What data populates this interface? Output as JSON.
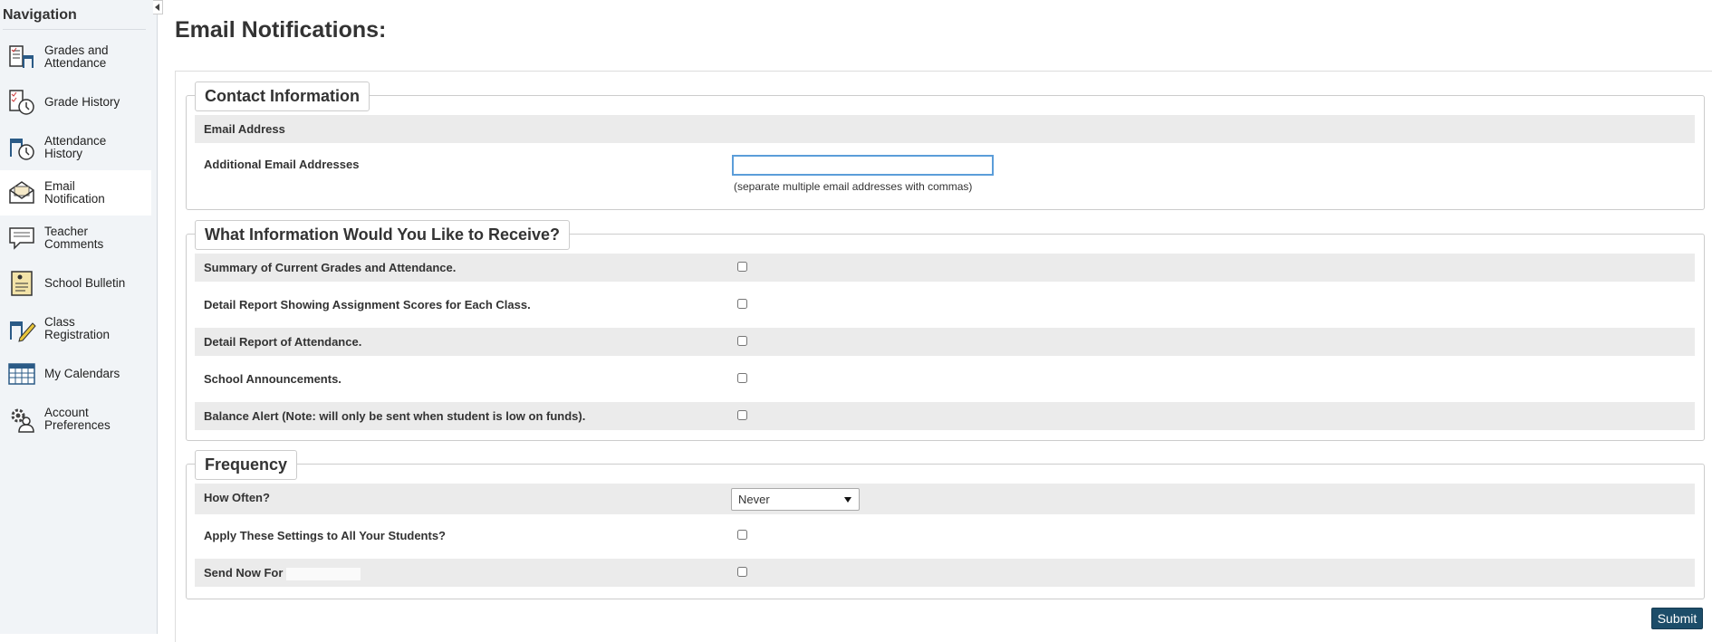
{
  "sidebar": {
    "title": "Navigation",
    "items": [
      {
        "label": "Grades and Attendance",
        "icon": "grades-attendance-icon",
        "active": false
      },
      {
        "label": "Grade History",
        "icon": "grade-history-icon",
        "active": false
      },
      {
        "label": "Attendance History",
        "icon": "attendance-history-icon",
        "active": false
      },
      {
        "label": "Email Notification",
        "icon": "email-notification-icon",
        "active": true
      },
      {
        "label": "Teacher Comments",
        "icon": "teacher-comments-icon",
        "active": false
      },
      {
        "label": "School Bulletin",
        "icon": "school-bulletin-icon",
        "active": false
      },
      {
        "label": "Class Registration",
        "icon": "class-registration-icon",
        "active": false
      },
      {
        "label": "My Calendars",
        "icon": "my-calendars-icon",
        "active": false
      },
      {
        "label": "Account Preferences",
        "icon": "account-preferences-icon",
        "active": false
      }
    ]
  },
  "page": {
    "title": "Email Notifications:"
  },
  "contact": {
    "legend": "Contact Information",
    "email_label": "Email Address",
    "additional_label": "Additional Email Addresses",
    "additional_value": "",
    "hint": "(separate multiple email addresses with commas)"
  },
  "receive": {
    "legend": "What Information Would You Like to Receive?",
    "options": [
      {
        "label": "Summary of Current Grades and Attendance.",
        "checked": false
      },
      {
        "label": "Detail Report Showing Assignment Scores for Each Class.",
        "checked": false
      },
      {
        "label": "Detail Report of Attendance.",
        "checked": false
      },
      {
        "label": "School Announcements.",
        "checked": false
      },
      {
        "label": "Balance Alert (Note: will only be sent when student is low on funds).",
        "checked": false
      }
    ]
  },
  "frequency": {
    "legend": "Frequency",
    "how_often_label": "How Often?",
    "how_often_value": "Never",
    "apply_label": "Apply These Settings to All Your Students?",
    "apply_checked": false,
    "send_now_label": "Send Now For",
    "send_now_checked": false
  },
  "actions": {
    "submit_label": "Submit"
  },
  "colors": {
    "submit_bg": "#1d4d69",
    "focus_border": "#5b9dd9",
    "row_shade": "#ebebeb",
    "sidebar_bg": "#f1f4f7"
  }
}
